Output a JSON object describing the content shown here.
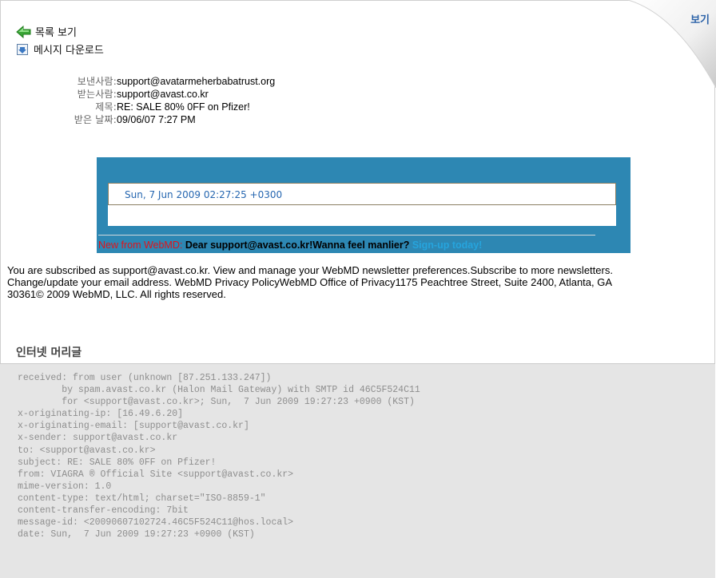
{
  "toolbar": {
    "view_label": "보기",
    "back_to_list_label": "목록 보기",
    "download_label": "메시지 다운로드"
  },
  "header": {
    "from_label": "보낸사람:",
    "from_value": "support@avatarmeherbabatrust.org",
    "to_label": "받는사람:",
    "to_value": "support@avast.co.kr",
    "subject_label": "제목:",
    "subject_value": "RE: SALE 80% 0FF on Pfizer!",
    "date_label": "받은 날짜:",
    "date_value": "09/06/07 7:27 PM"
  },
  "body": {
    "banner_date": "Sun, 7 Jun 2009 02:27:25 +0300",
    "webmd_prefix": "New from WebMD:",
    "webmd_message": " Dear support@avast.co.kr!Wanna feel manlier?",
    "webmd_signup": " Sign-up today!",
    "footer_lines": [
      "You are subscribed as support@avast.co.kr. View and manage your WebMD newsletter preferences.Subscribe to more newsletters.",
      "Change/update your email address. WebMD Privacy PolicyWebMD Office of Privacy1175 Peachtree Street, Suite 2400, Atlanta, GA",
      "30361© 2009 WebMD, LLC. All rights reserved."
    ]
  },
  "headers_section": {
    "title": "인터넷 머리글",
    "raw": "received: from user (unknown [87.251.133.247])\n        by spam.avast.co.kr (Halon Mail Gateway) with SMTP id 46C5F524C11\n        for <support@avast.co.kr>; Sun,  7 Jun 2009 19:27:23 +0900 (KST)\nx-originating-ip: [16.49.6.20]\nx-originating-email: [support@avast.co.kr]\nx-sender: support@avast.co.kr\nto: <support@avast.co.kr>\nsubject: RE: SALE 80% 0FF on Pfizer!\nfrom: VIAGRA ® Official Site <support@avast.co.kr>\nmime-version: 1.0\ncontent-type: text/html; charset=\"ISO-8859-1\"\ncontent-transfer-encoding: 7bit\nmessage-id: <20090607102724.46C5F524C11@hos.local>\ndate: Sun,  7 Jun 2009 19:27:23 +0900 (KST)"
  },
  "colors": {
    "banner_bg": "#2d87b3",
    "link_blue": "#2b62a8",
    "webmd_red": "#e0141b",
    "signup_cyan": "#26a4dd",
    "raw_bg": "#e5e5e5"
  },
  "icons": {
    "back": "green-arrow-left-icon",
    "download": "download-icon"
  }
}
